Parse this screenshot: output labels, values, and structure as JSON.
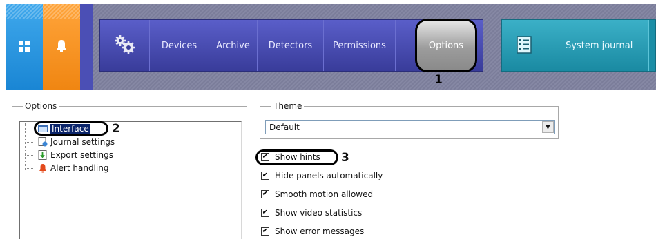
{
  "topbar": {
    "tiles": [
      {
        "name": "home-tile",
        "icon": "windows-grid-icon",
        "color": "#2b97e0"
      },
      {
        "name": "alerts-tile",
        "icon": "bell-icon",
        "color": "#f7931e"
      }
    ],
    "nav": [
      {
        "key": "devices",
        "label": "Devices"
      },
      {
        "key": "archive",
        "label": "Archive"
      },
      {
        "key": "detectors",
        "label": "Detectors"
      },
      {
        "key": "permissions",
        "label": "Permissions"
      },
      {
        "key": "options",
        "label": "Options",
        "active": true
      }
    ],
    "journal": {
      "label": "System journal",
      "icon": "journal-icon"
    },
    "nav_color": "#4a4eb8",
    "journal_color": "#2aa0b8"
  },
  "callouts": {
    "one": "1",
    "two": "2",
    "three": "3"
  },
  "options_panel": {
    "legend": "Options",
    "tree": [
      {
        "label": "Interface",
        "icon": "interface-icon",
        "selected": true
      },
      {
        "label": "Journal settings",
        "icon": "journal-settings-icon"
      },
      {
        "label": "Export settings",
        "icon": "export-icon"
      },
      {
        "label": "Alert handling",
        "icon": "alert-icon"
      }
    ]
  },
  "theme": {
    "legend": "Theme",
    "value": "Default"
  },
  "checkboxes": [
    {
      "label": "Show hints",
      "checked": true
    },
    {
      "label": "Hide panels automatically",
      "checked": true
    },
    {
      "label": "Smooth motion allowed",
      "checked": true
    },
    {
      "label": "Show video statistics",
      "checked": true
    },
    {
      "label": "Show error messages",
      "checked": true
    }
  ]
}
